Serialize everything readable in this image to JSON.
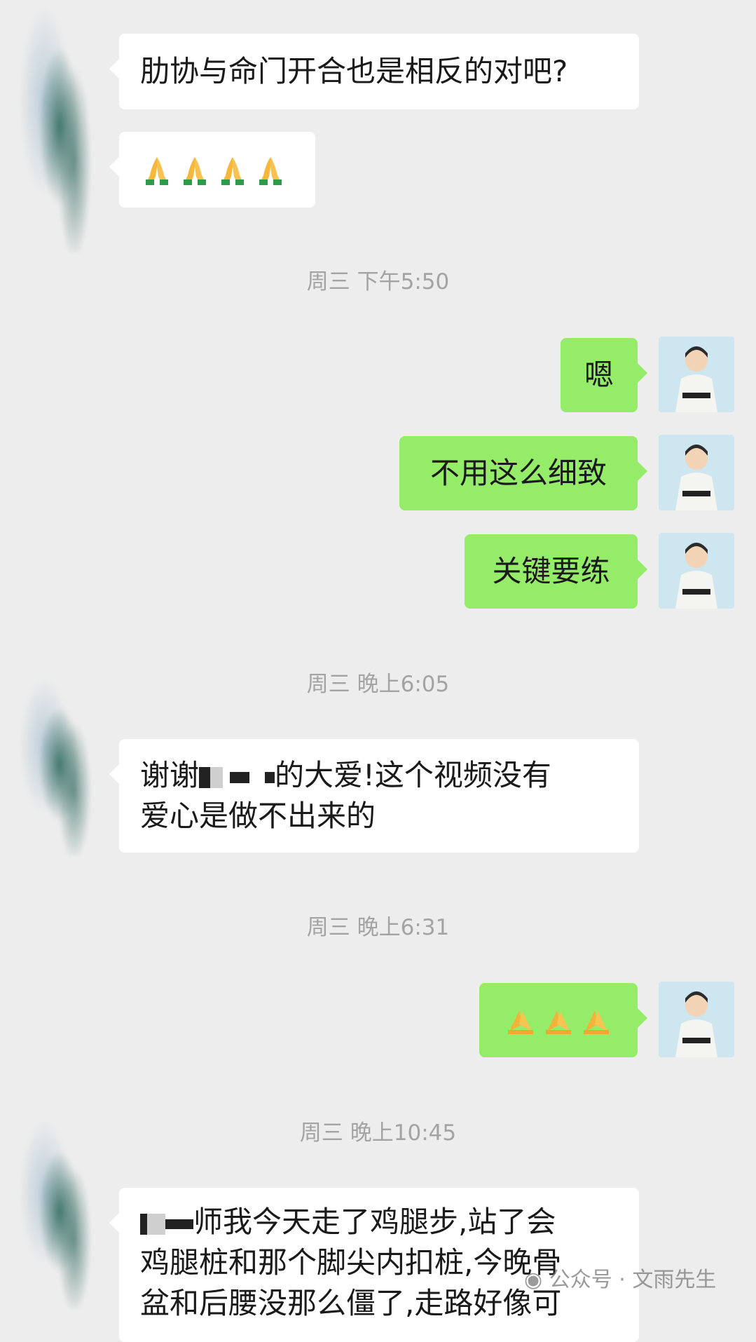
{
  "messages": {
    "m1": "肋协与命门开合也是相反的对吧?",
    "m2_emoji": "🙏🙏🙏🙏",
    "m3": "嗯",
    "m4": "不用这么细致",
    "m5": "关键要练",
    "m6_a": "谢谢",
    "m6_b": "的大爱!这个视频没有",
    "m6_c": "爱心是做不出来的",
    "m7_emoji": "🙏🙏🙏",
    "m8_a": "师我今天走了鸡腿步,站了会",
    "m8_b": "鸡腿桩和那个脚尖内扣桩,今晚骨",
    "m8_c": "盆和后腰没那么僵了,走路好像可"
  },
  "timestamps": {
    "t1": "周三 下午5:50",
    "t2": "周三 晚上6:05",
    "t3": "周三 晚上6:31",
    "t4": "周三 晚上10:45"
  },
  "watermark": "公众号 · 文雨先生",
  "colors": {
    "background": "#ededed",
    "incoming_bubble": "#ffffff",
    "outgoing_bubble": "#95ec69",
    "timestamp_text": "#a3a3a3"
  }
}
